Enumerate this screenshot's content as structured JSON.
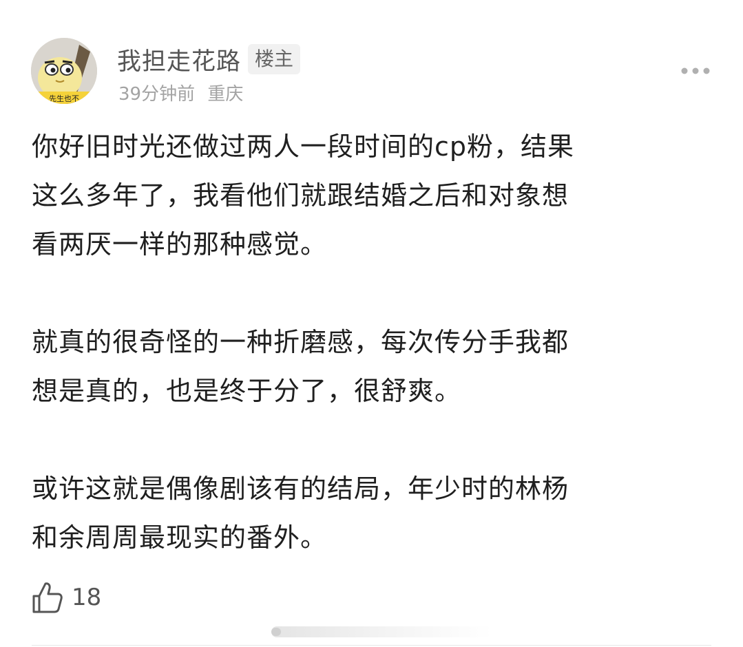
{
  "author": {
    "name": "我担走花路",
    "badge": "楼主",
    "time": "39分钟前",
    "location": "重庆",
    "avatar_caption": "…先生也不…"
  },
  "post": {
    "paragraphs": [
      "你好旧时光还做过两人一段时间的cp粉，结果\n这么多年了，我看他们就跟结婚之后和对象想\n看两厌一样的那种感觉。",
      "就真的很奇怪的一种折磨感，每次传分手我都\n想是真的，也是终于分了，很舒爽。",
      "或许这就是偶像剧该有的结局，年少时的林杨\n和余周周最现实的番外。"
    ]
  },
  "footer": {
    "like_count": "18"
  },
  "icons": {
    "more": "more-dots-icon",
    "like": "thumbs-up-icon"
  },
  "colors": {
    "text": "#1f1f1f",
    "meta": "#a3a3a3",
    "badge_bg": "#f1f1f1"
  }
}
